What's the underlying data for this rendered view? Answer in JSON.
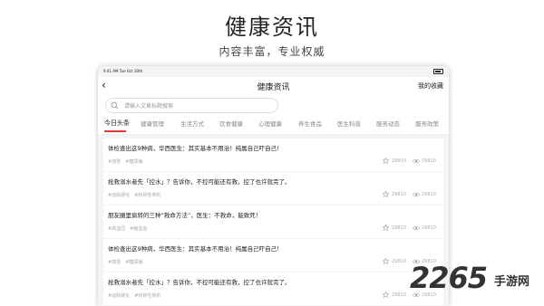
{
  "hero": {
    "title": "健康资讯",
    "subtitle": "内容丰富，专业权威"
  },
  "status_bar": {
    "time": "9:41 AM  Tue Oct 30th"
  },
  "navbar": {
    "back_icon": "chevron-left-icon",
    "title": "健康资讯",
    "right_label": "我的收藏"
  },
  "search": {
    "icon": "search-icon",
    "placeholder": "请输入文章标题搜索"
  },
  "tabs": [
    {
      "label": "今日头条",
      "active": true
    },
    {
      "label": "健康管理",
      "active": false
    },
    {
      "label": "生活方式",
      "active": false
    },
    {
      "label": "饮食健康",
      "active": false
    },
    {
      "label": "心理健康",
      "active": false
    },
    {
      "label": "养生食品",
      "active": false
    },
    {
      "label": "医生科普",
      "active": false
    },
    {
      "label": "服务动态",
      "active": false
    },
    {
      "label": "服务政策",
      "active": false
    }
  ],
  "articles": [
    {
      "title": "体检查出这9种病，华西医生：其实基本不用治！纯属自己吓自己！",
      "tags": [
        "#感冒",
        "#糖尿病"
      ],
      "stars": "29810",
      "views": "29810"
    },
    {
      "title": "抢救溺水者先「控水」？告诉你，不控可能还有救，控了也许就完了。",
      "tags": [
        "#动脉硬化",
        "#粉碎性骨折"
      ],
      "stars": "29810",
      "views": "29810"
    },
    {
      "title": "朋友圈里疯转的三种“救命方法”，医生：不救命，能致死！",
      "tags": [
        "#高血压",
        "#脑溢血"
      ],
      "stars": "29810",
      "views": "29810"
    },
    {
      "title": "体检查出这9种病，华西医生：其实基本不用治！纯属自己吓自己！",
      "tags": [
        "#感冒",
        "#糖尿病"
      ],
      "stars": "29810",
      "views": "29810"
    },
    {
      "title": "抢救溺水者先「控水」？告诉你，不控可能还有救，控了也许就完了。",
      "tags": [
        "#动脉硬化",
        "#粉碎性骨折"
      ],
      "stars": "29810",
      "views": "29810"
    }
  ],
  "watermark": {
    "number": "2265",
    "text": "手游网"
  },
  "colors": {
    "accent": "#e03a3a"
  }
}
